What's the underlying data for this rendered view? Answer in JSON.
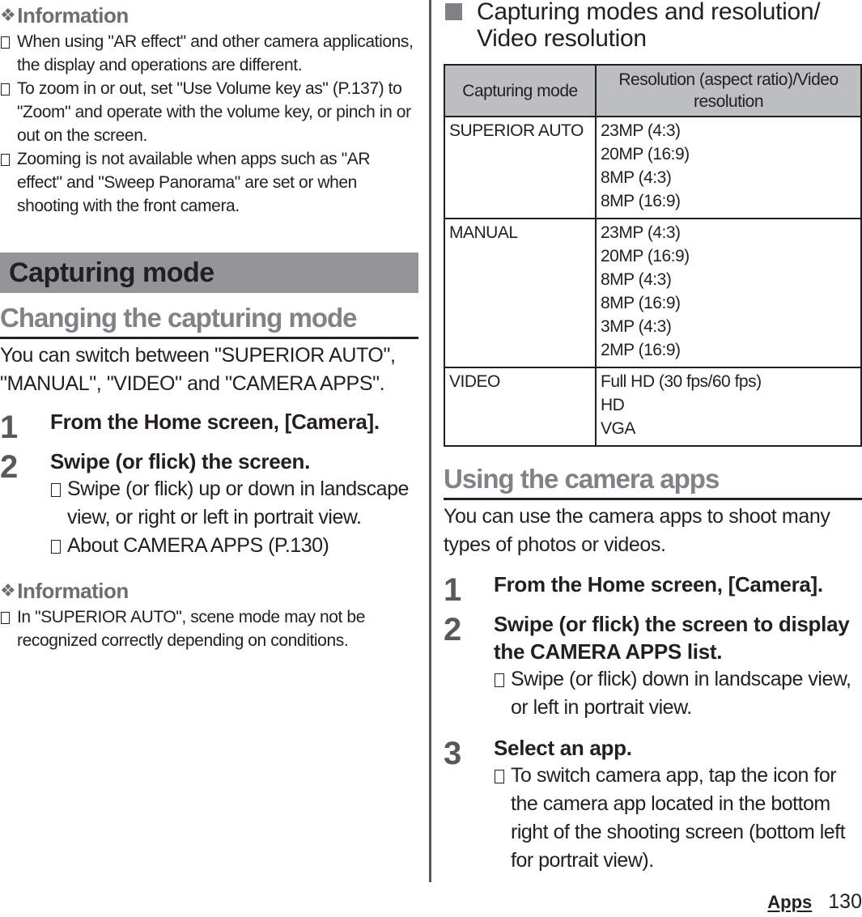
{
  "left": {
    "info1": {
      "heading": "Information",
      "items": [
        "When using \"AR effect\" and other camera applications, the display and operations are different.",
        "To zoom in or out, set \"Use Volume key as\" (P.137) to \"Zoom\" and operate with the volume key, or pinch in or out on the screen.",
        "Zooming is not available when apps such as \"AR effect\" and \"Sweep Panorama\" are set or when shooting with the front camera."
      ]
    },
    "section_title": "Capturing mode",
    "subsection_title": "Changing the capturing mode",
    "intro": "You can switch between \"SUPERIOR AUTO\", \"MANUAL\", \"VIDEO\" and \"CAMERA APPS\".",
    "steps": [
      {
        "num": "1",
        "title": "From the Home screen, [Camera].",
        "notes": []
      },
      {
        "num": "2",
        "title": "Swipe (or flick) the screen.",
        "notes": [
          "Swipe (or flick) up or down in landscape view, or right or left in portrait view.",
          "About CAMERA APPS (P.130)"
        ]
      }
    ],
    "info2": {
      "heading": "Information",
      "items": [
        "In \"SUPERIOR AUTO\", scene mode may not be recognized correctly depending on conditions."
      ]
    }
  },
  "right": {
    "table_heading": "Capturing modes and resolution/ Video resolution",
    "table": {
      "headers": [
        "Capturing mode",
        "Resolution (aspect ratio)/Video resolution"
      ],
      "rows": [
        {
          "mode": "SUPERIOR AUTO",
          "values": [
            "23MP (4:3)",
            "20MP (16:9)",
            "8MP (4:3)",
            "8MP (16:9)"
          ]
        },
        {
          "mode": "MANUAL",
          "values": [
            "23MP (4:3)",
            "20MP (16:9)",
            "8MP (4:3)",
            "8MP (16:9)",
            "3MP (4:3)",
            "2MP (16:9)"
          ]
        },
        {
          "mode": "VIDEO",
          "values": [
            "Full HD (30 fps/60 fps)",
            "HD",
            "VGA"
          ]
        }
      ]
    },
    "subsection_title": "Using the camera apps",
    "intro": "You can use the camera apps to shoot many types of photos or videos.",
    "steps": [
      {
        "num": "1",
        "title": "From the Home screen, [Camera].",
        "notes": []
      },
      {
        "num": "2",
        "title": "Swipe (or flick) the screen to display the CAMERA APPS list.",
        "notes": [
          "Swipe (or flick) down in landscape view, or left in portrait view."
        ]
      },
      {
        "num": "3",
        "title": "Select an app.",
        "notes": [
          "To switch camera app, tap the icon for the camera app located in the bottom right of the shooting screen (bottom left for portrait view)."
        ]
      }
    ]
  },
  "footer": {
    "section": "Apps",
    "page": "130"
  }
}
